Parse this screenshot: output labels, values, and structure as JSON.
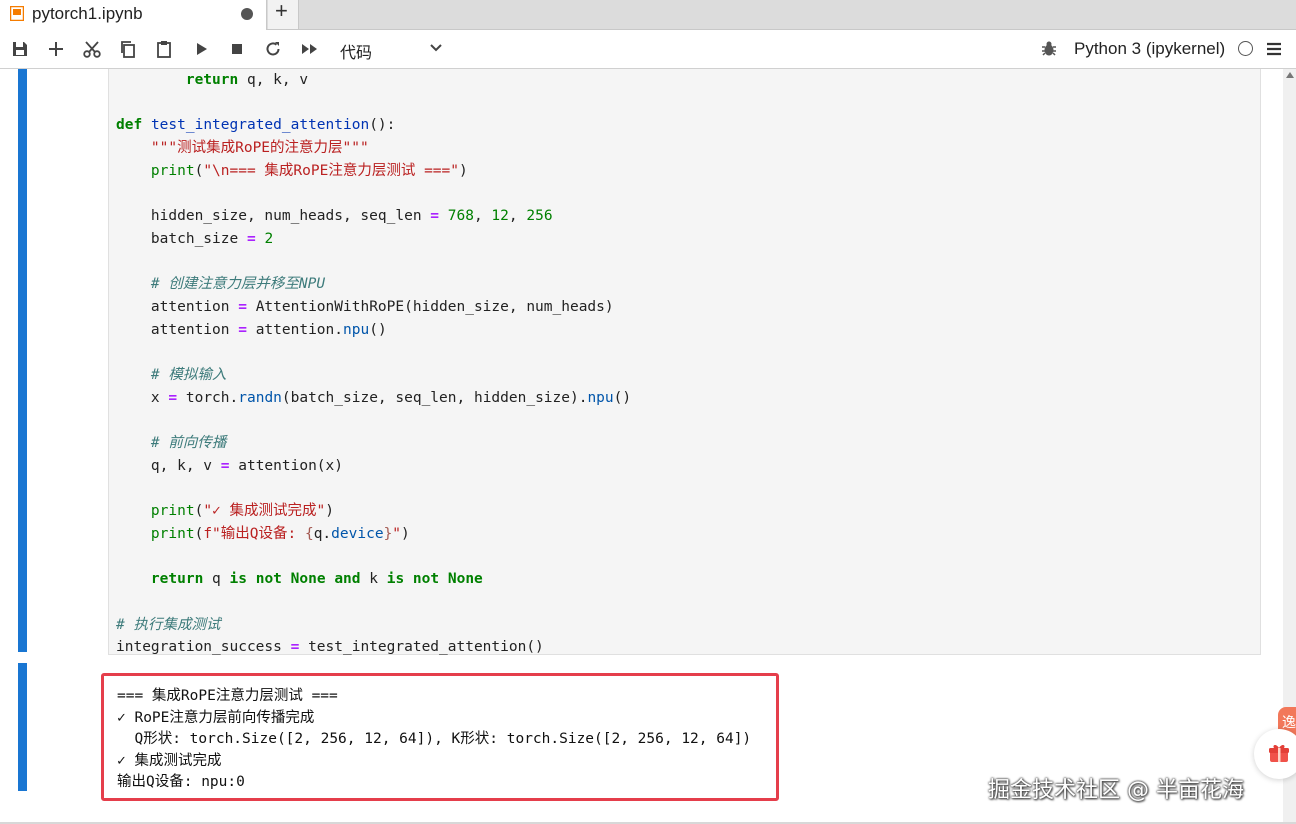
{
  "tab": {
    "title": "pytorch1.ipynb",
    "new_tab_label": "+"
  },
  "toolbar": {
    "icons": [
      "save-icon",
      "add-cell-icon",
      "cut-icon",
      "copy-icon",
      "paste-icon",
      "run-icon",
      "stop-icon",
      "restart-icon",
      "run-all-icon"
    ],
    "cell_type": "代码",
    "kernel_name": "Python 3 (ipykernel)"
  },
  "code": {
    "l0": [
      "return",
      " q, k, v"
    ],
    "l2": [
      "def",
      "test_integrated_attention",
      "():"
    ],
    "l3": "\"\"\"测试集成RoPE的注意力层\"\"\"",
    "l4": [
      "print",
      "(",
      "\"\\n=== 集成RoPE注意力层测试 ===\"",
      ")"
    ],
    "l6": [
      "hidden_size, num_heads, seq_len",
      "=",
      "768",
      "12",
      "256"
    ],
    "l7": [
      "batch_size",
      "=",
      "2"
    ],
    "l9": "# 创建注意力层并移至NPU",
    "l10": [
      "attention",
      "=",
      "AttentionWithRoPE(hidden_size, num_heads)"
    ],
    "l11": [
      "attention",
      "=",
      "attention.",
      "npu",
      "()"
    ],
    "l13": "# 模拟输入",
    "l14": [
      "x",
      "=",
      "torch.",
      "randn",
      "(batch_size, seq_len, hidden_size).",
      "npu",
      "()"
    ],
    "l16": "# 前向传播",
    "l17": [
      "q, k, v",
      "=",
      "attention(x)"
    ],
    "l19": [
      "print",
      "(",
      "\"✓ 集成测试完成\"",
      ")"
    ],
    "l20": [
      "print",
      "(",
      "f\"输出Q设备: ",
      "{",
      "q.",
      "device",
      "}",
      "\"",
      ")"
    ],
    "l22": [
      "return",
      " q ",
      "is",
      "not",
      "None",
      "and",
      " k ",
      "is",
      "not",
      "None"
    ],
    "l24": "# 执行集成测试",
    "l25": [
      "integration_success",
      "=",
      "test_integrated_attention()"
    ]
  },
  "output": {
    "lines": [
      "=== 集成RoPE注意力层测试 ===",
      "✓ RoPE注意力层前向传播完成",
      "  Q形状: torch.Size([2, 256, 12, 64]), K形状: torch.Size([2, 256, 12, 64])",
      "✓ 集成测试完成",
      "输出Q设备: npu:0"
    ]
  },
  "floating": {
    "badge_text": "逸"
  },
  "watermark": "掘金技术社区 @ 半亩花海",
  "colors": {
    "cell_bar": "#1976d2",
    "output_highlight": "#e53e4b",
    "keyword": "#008000",
    "string": "#ba2121"
  }
}
